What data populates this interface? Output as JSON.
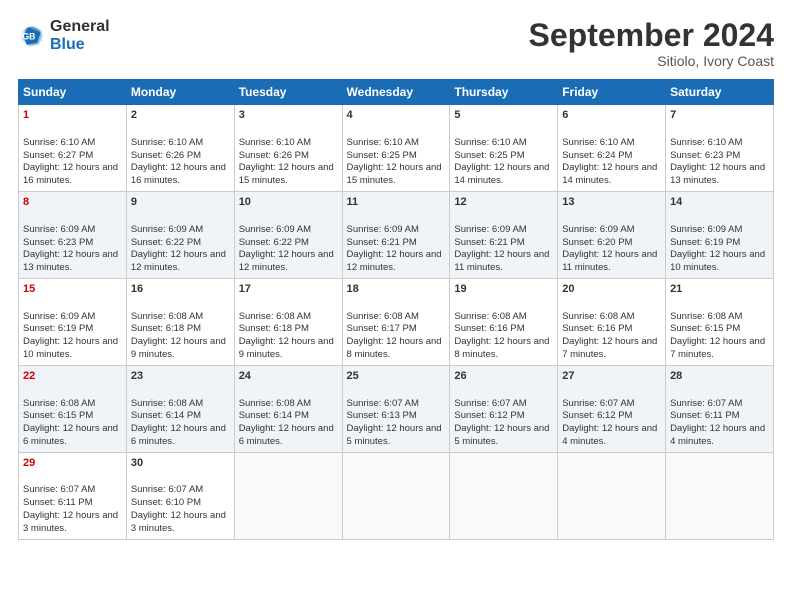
{
  "header": {
    "logo_general": "General",
    "logo_blue": "Blue",
    "month_title": "September 2024",
    "location": "Sitiolo, Ivory Coast"
  },
  "days_of_week": [
    "Sunday",
    "Monday",
    "Tuesday",
    "Wednesday",
    "Thursday",
    "Friday",
    "Saturday"
  ],
  "weeks": [
    [
      {
        "day": 1,
        "sunrise": "6:10 AM",
        "sunset": "6:27 PM",
        "daylight": "12 hours and 16 minutes."
      },
      {
        "day": 2,
        "sunrise": "6:10 AM",
        "sunset": "6:26 PM",
        "daylight": "12 hours and 16 minutes."
      },
      {
        "day": 3,
        "sunrise": "6:10 AM",
        "sunset": "6:26 PM",
        "daylight": "12 hours and 15 minutes."
      },
      {
        "day": 4,
        "sunrise": "6:10 AM",
        "sunset": "6:25 PM",
        "daylight": "12 hours and 15 minutes."
      },
      {
        "day": 5,
        "sunrise": "6:10 AM",
        "sunset": "6:25 PM",
        "daylight": "12 hours and 14 minutes."
      },
      {
        "day": 6,
        "sunrise": "6:10 AM",
        "sunset": "6:24 PM",
        "daylight": "12 hours and 14 minutes."
      },
      {
        "day": 7,
        "sunrise": "6:10 AM",
        "sunset": "6:23 PM",
        "daylight": "12 hours and 13 minutes."
      }
    ],
    [
      {
        "day": 8,
        "sunrise": "6:09 AM",
        "sunset": "6:23 PM",
        "daylight": "12 hours and 13 minutes."
      },
      {
        "day": 9,
        "sunrise": "6:09 AM",
        "sunset": "6:22 PM",
        "daylight": "12 hours and 12 minutes."
      },
      {
        "day": 10,
        "sunrise": "6:09 AM",
        "sunset": "6:22 PM",
        "daylight": "12 hours and 12 minutes."
      },
      {
        "day": 11,
        "sunrise": "6:09 AM",
        "sunset": "6:21 PM",
        "daylight": "12 hours and 12 minutes."
      },
      {
        "day": 12,
        "sunrise": "6:09 AM",
        "sunset": "6:21 PM",
        "daylight": "12 hours and 11 minutes."
      },
      {
        "day": 13,
        "sunrise": "6:09 AM",
        "sunset": "6:20 PM",
        "daylight": "12 hours and 11 minutes."
      },
      {
        "day": 14,
        "sunrise": "6:09 AM",
        "sunset": "6:19 PM",
        "daylight": "12 hours and 10 minutes."
      }
    ],
    [
      {
        "day": 15,
        "sunrise": "6:09 AM",
        "sunset": "6:19 PM",
        "daylight": "12 hours and 10 minutes."
      },
      {
        "day": 16,
        "sunrise": "6:08 AM",
        "sunset": "6:18 PM",
        "daylight": "12 hours and 9 minutes."
      },
      {
        "day": 17,
        "sunrise": "6:08 AM",
        "sunset": "6:18 PM",
        "daylight": "12 hours and 9 minutes."
      },
      {
        "day": 18,
        "sunrise": "6:08 AM",
        "sunset": "6:17 PM",
        "daylight": "12 hours and 8 minutes."
      },
      {
        "day": 19,
        "sunrise": "6:08 AM",
        "sunset": "6:16 PM",
        "daylight": "12 hours and 8 minutes."
      },
      {
        "day": 20,
        "sunrise": "6:08 AM",
        "sunset": "6:16 PM",
        "daylight": "12 hours and 7 minutes."
      },
      {
        "day": 21,
        "sunrise": "6:08 AM",
        "sunset": "6:15 PM",
        "daylight": "12 hours and 7 minutes."
      }
    ],
    [
      {
        "day": 22,
        "sunrise": "6:08 AM",
        "sunset": "6:15 PM",
        "daylight": "12 hours and 6 minutes."
      },
      {
        "day": 23,
        "sunrise": "6:08 AM",
        "sunset": "6:14 PM",
        "daylight": "12 hours and 6 minutes."
      },
      {
        "day": 24,
        "sunrise": "6:08 AM",
        "sunset": "6:14 PM",
        "daylight": "12 hours and 6 minutes."
      },
      {
        "day": 25,
        "sunrise": "6:07 AM",
        "sunset": "6:13 PM",
        "daylight": "12 hours and 5 minutes."
      },
      {
        "day": 26,
        "sunrise": "6:07 AM",
        "sunset": "6:12 PM",
        "daylight": "12 hours and 5 minutes."
      },
      {
        "day": 27,
        "sunrise": "6:07 AM",
        "sunset": "6:12 PM",
        "daylight": "12 hours and 4 minutes."
      },
      {
        "day": 28,
        "sunrise": "6:07 AM",
        "sunset": "6:11 PM",
        "daylight": "12 hours and 4 minutes."
      }
    ],
    [
      {
        "day": 29,
        "sunrise": "6:07 AM",
        "sunset": "6:11 PM",
        "daylight": "12 hours and 3 minutes."
      },
      {
        "day": 30,
        "sunrise": "6:07 AM",
        "sunset": "6:10 PM",
        "daylight": "12 hours and 3 minutes."
      },
      null,
      null,
      null,
      null,
      null
    ]
  ]
}
